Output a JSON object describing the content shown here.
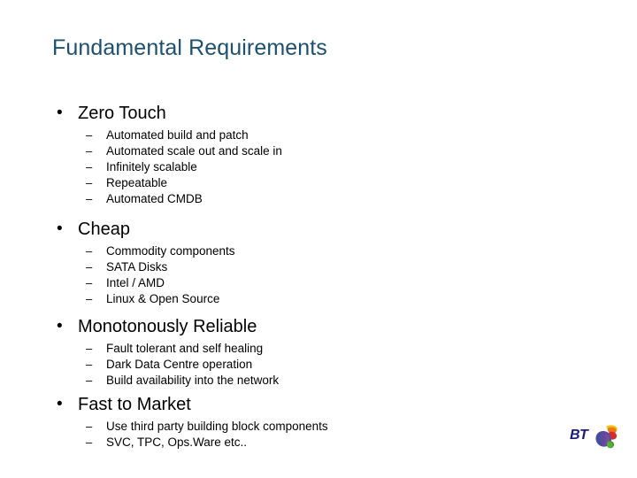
{
  "slide": {
    "title": "Fundamental Requirements",
    "title_color": "#1d5070",
    "background_color": "#ffffff",
    "text_color": "#000000",
    "bullet_glyph": "•",
    "subbullet_glyph": "–"
  },
  "groups": [
    {
      "heading": "Zero Touch",
      "items": [
        "Automated build and patch",
        "Automated scale out and scale in",
        "Infinitely scalable",
        "Repeatable",
        "Automated CMDB"
      ]
    },
    {
      "heading": "Cheap",
      "items": [
        "Commodity components",
        "SATA Disks",
        "Intel / AMD",
        "Linux & Open Source"
      ]
    },
    {
      "heading": "Monotonously Reliable",
      "items": [
        "Fault tolerant and self healing",
        "Dark Data Centre operation",
        "Build availability into the network"
      ]
    },
    {
      "heading": "Fast to Market",
      "items": [
        "Use third party building block components",
        "SVC, TPC, Ops.Ware etc.."
      ]
    }
  ],
  "logo": {
    "wordmark": "BT",
    "wordmark_color": "#1b1b7d",
    "globe_colors": {
      "sphere_violet": "#5b4a9e",
      "sphere_blue": "#3f4fa0",
      "arc_orange": "#e8761a",
      "arc_red": "#d62b2b",
      "arc_yellow": "#f2c10e",
      "leaf_green": "#3f9b35"
    }
  }
}
